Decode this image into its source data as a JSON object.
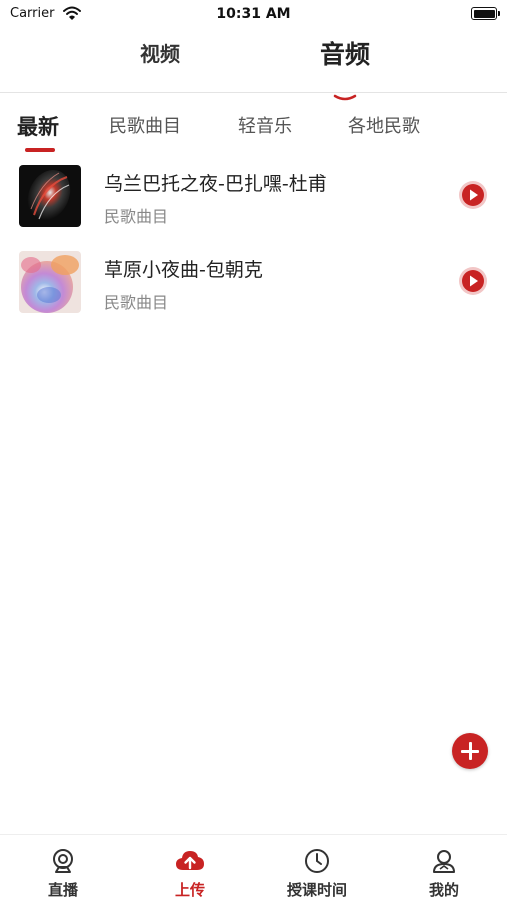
{
  "status_bar": {
    "carrier": "Carrier",
    "time": "10:31 AM"
  },
  "top_tabs": {
    "video": "视频",
    "audio": "音频",
    "active": "audio"
  },
  "category_tabs": {
    "items": [
      {
        "label": "最新",
        "active": true
      },
      {
        "label": "民歌曲目",
        "active": false
      },
      {
        "label": "轻音乐",
        "active": false
      },
      {
        "label": "各地民歌",
        "active": false
      }
    ]
  },
  "tracks": [
    {
      "title": "乌兰巴托之夜-巴扎嘿-杜甫",
      "category": "民歌曲目"
    },
    {
      "title": "草原小夜曲-包朝克",
      "category": "民歌曲目"
    }
  ],
  "bottom_nav": {
    "items": [
      {
        "label": "直播",
        "icon": "webcam-icon",
        "active": false
      },
      {
        "label": "上传",
        "icon": "cloud-upload-icon",
        "active": true
      },
      {
        "label": "授课时间",
        "icon": "clock-icon",
        "active": false
      },
      {
        "label": "我的",
        "icon": "user-icon",
        "active": false
      }
    ]
  },
  "colors": {
    "accent": "#c82323",
    "text": "#222222",
    "subtext": "#888888"
  }
}
